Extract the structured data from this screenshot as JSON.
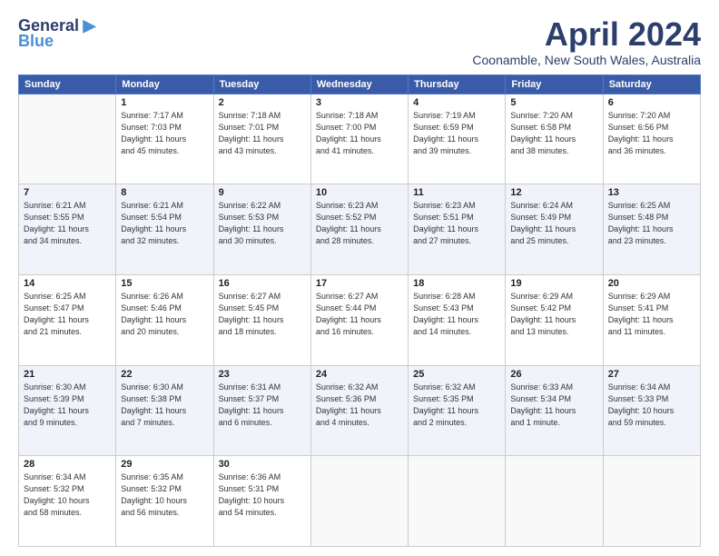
{
  "header": {
    "logo_line1": "General",
    "logo_line2": "Blue",
    "month": "April 2024",
    "location": "Coonamble, New South Wales, Australia"
  },
  "days_of_week": [
    "Sunday",
    "Monday",
    "Tuesday",
    "Wednesday",
    "Thursday",
    "Friday",
    "Saturday"
  ],
  "weeks": [
    [
      {
        "num": "",
        "info": ""
      },
      {
        "num": "1",
        "info": "Sunrise: 7:17 AM\nSunset: 7:03 PM\nDaylight: 11 hours\nand 45 minutes."
      },
      {
        "num": "2",
        "info": "Sunrise: 7:18 AM\nSunset: 7:01 PM\nDaylight: 11 hours\nand 43 minutes."
      },
      {
        "num": "3",
        "info": "Sunrise: 7:18 AM\nSunset: 7:00 PM\nDaylight: 11 hours\nand 41 minutes."
      },
      {
        "num": "4",
        "info": "Sunrise: 7:19 AM\nSunset: 6:59 PM\nDaylight: 11 hours\nand 39 minutes."
      },
      {
        "num": "5",
        "info": "Sunrise: 7:20 AM\nSunset: 6:58 PM\nDaylight: 11 hours\nand 38 minutes."
      },
      {
        "num": "6",
        "info": "Sunrise: 7:20 AM\nSunset: 6:56 PM\nDaylight: 11 hours\nand 36 minutes."
      }
    ],
    [
      {
        "num": "7",
        "info": "Sunrise: 6:21 AM\nSunset: 5:55 PM\nDaylight: 11 hours\nand 34 minutes."
      },
      {
        "num": "8",
        "info": "Sunrise: 6:21 AM\nSunset: 5:54 PM\nDaylight: 11 hours\nand 32 minutes."
      },
      {
        "num": "9",
        "info": "Sunrise: 6:22 AM\nSunset: 5:53 PM\nDaylight: 11 hours\nand 30 minutes."
      },
      {
        "num": "10",
        "info": "Sunrise: 6:23 AM\nSunset: 5:52 PM\nDaylight: 11 hours\nand 28 minutes."
      },
      {
        "num": "11",
        "info": "Sunrise: 6:23 AM\nSunset: 5:51 PM\nDaylight: 11 hours\nand 27 minutes."
      },
      {
        "num": "12",
        "info": "Sunrise: 6:24 AM\nSunset: 5:49 PM\nDaylight: 11 hours\nand 25 minutes."
      },
      {
        "num": "13",
        "info": "Sunrise: 6:25 AM\nSunset: 5:48 PM\nDaylight: 11 hours\nand 23 minutes."
      }
    ],
    [
      {
        "num": "14",
        "info": "Sunrise: 6:25 AM\nSunset: 5:47 PM\nDaylight: 11 hours\nand 21 minutes."
      },
      {
        "num": "15",
        "info": "Sunrise: 6:26 AM\nSunset: 5:46 PM\nDaylight: 11 hours\nand 20 minutes."
      },
      {
        "num": "16",
        "info": "Sunrise: 6:27 AM\nSunset: 5:45 PM\nDaylight: 11 hours\nand 18 minutes."
      },
      {
        "num": "17",
        "info": "Sunrise: 6:27 AM\nSunset: 5:44 PM\nDaylight: 11 hours\nand 16 minutes."
      },
      {
        "num": "18",
        "info": "Sunrise: 6:28 AM\nSunset: 5:43 PM\nDaylight: 11 hours\nand 14 minutes."
      },
      {
        "num": "19",
        "info": "Sunrise: 6:29 AM\nSunset: 5:42 PM\nDaylight: 11 hours\nand 13 minutes."
      },
      {
        "num": "20",
        "info": "Sunrise: 6:29 AM\nSunset: 5:41 PM\nDaylight: 11 hours\nand 11 minutes."
      }
    ],
    [
      {
        "num": "21",
        "info": "Sunrise: 6:30 AM\nSunset: 5:39 PM\nDaylight: 11 hours\nand 9 minutes."
      },
      {
        "num": "22",
        "info": "Sunrise: 6:30 AM\nSunset: 5:38 PM\nDaylight: 11 hours\nand 7 minutes."
      },
      {
        "num": "23",
        "info": "Sunrise: 6:31 AM\nSunset: 5:37 PM\nDaylight: 11 hours\nand 6 minutes."
      },
      {
        "num": "24",
        "info": "Sunrise: 6:32 AM\nSunset: 5:36 PM\nDaylight: 11 hours\nand 4 minutes."
      },
      {
        "num": "25",
        "info": "Sunrise: 6:32 AM\nSunset: 5:35 PM\nDaylight: 11 hours\nand 2 minutes."
      },
      {
        "num": "26",
        "info": "Sunrise: 6:33 AM\nSunset: 5:34 PM\nDaylight: 11 hours\nand 1 minute."
      },
      {
        "num": "27",
        "info": "Sunrise: 6:34 AM\nSunset: 5:33 PM\nDaylight: 10 hours\nand 59 minutes."
      }
    ],
    [
      {
        "num": "28",
        "info": "Sunrise: 6:34 AM\nSunset: 5:32 PM\nDaylight: 10 hours\nand 58 minutes."
      },
      {
        "num": "29",
        "info": "Sunrise: 6:35 AM\nSunset: 5:32 PM\nDaylight: 10 hours\nand 56 minutes."
      },
      {
        "num": "30",
        "info": "Sunrise: 6:36 AM\nSunset: 5:31 PM\nDaylight: 10 hours\nand 54 minutes."
      },
      {
        "num": "",
        "info": ""
      },
      {
        "num": "",
        "info": ""
      },
      {
        "num": "",
        "info": ""
      },
      {
        "num": "",
        "info": ""
      }
    ]
  ]
}
